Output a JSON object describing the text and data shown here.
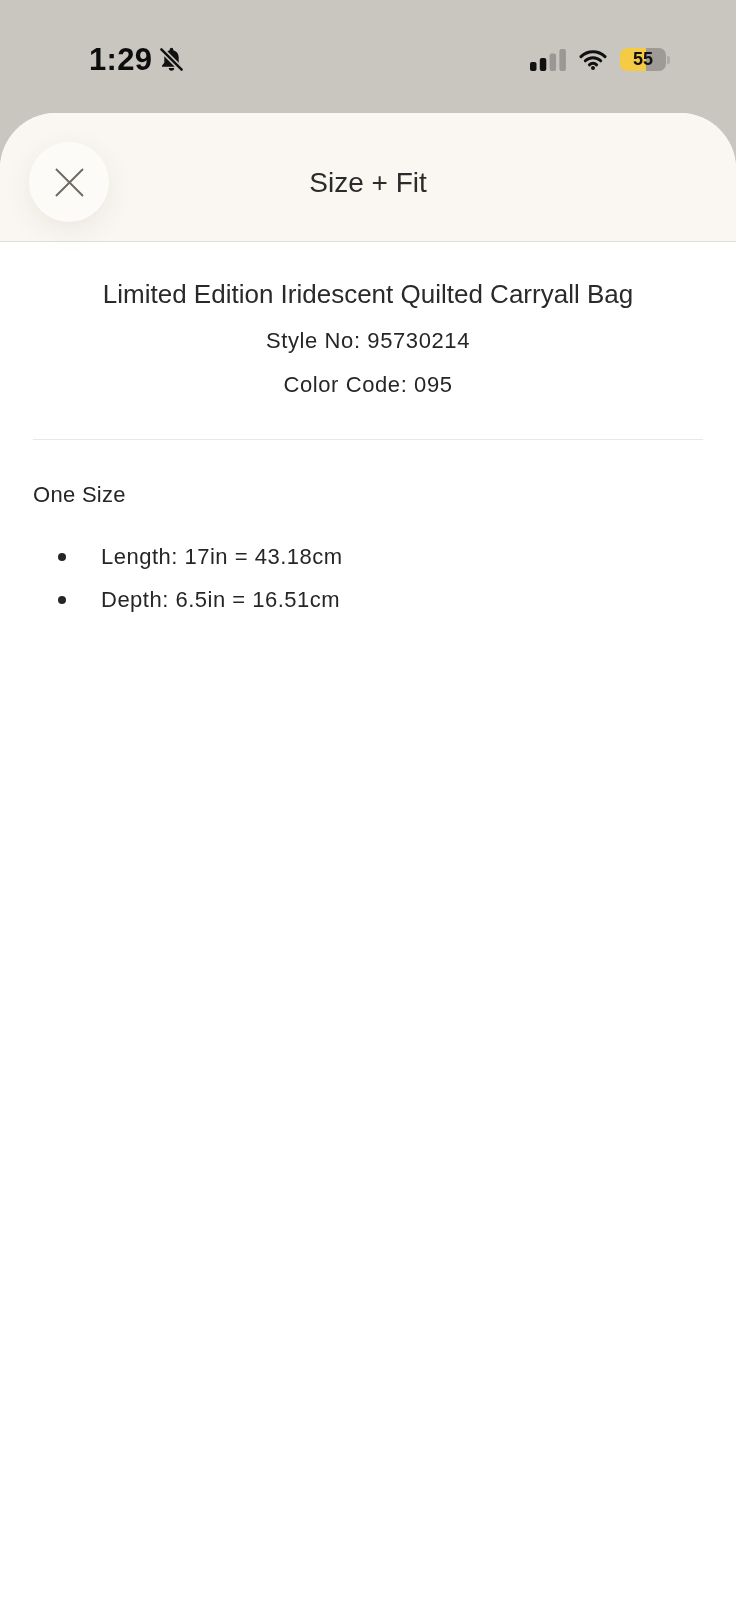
{
  "status_bar": {
    "time": "1:29",
    "silent": true,
    "battery_percent": "55",
    "low_power": true
  },
  "sheet": {
    "title": "Size + Fit"
  },
  "product": {
    "name": "Limited Edition Iridescent Quilted Carryall Bag",
    "style_number": "Style No: 95730214",
    "color_code": "Color Code: 095"
  },
  "size_info": {
    "heading": "One Size",
    "measurements": [
      "Length: 17in = 43.18cm",
      "Depth: 6.5in = 16.51cm"
    ]
  }
}
